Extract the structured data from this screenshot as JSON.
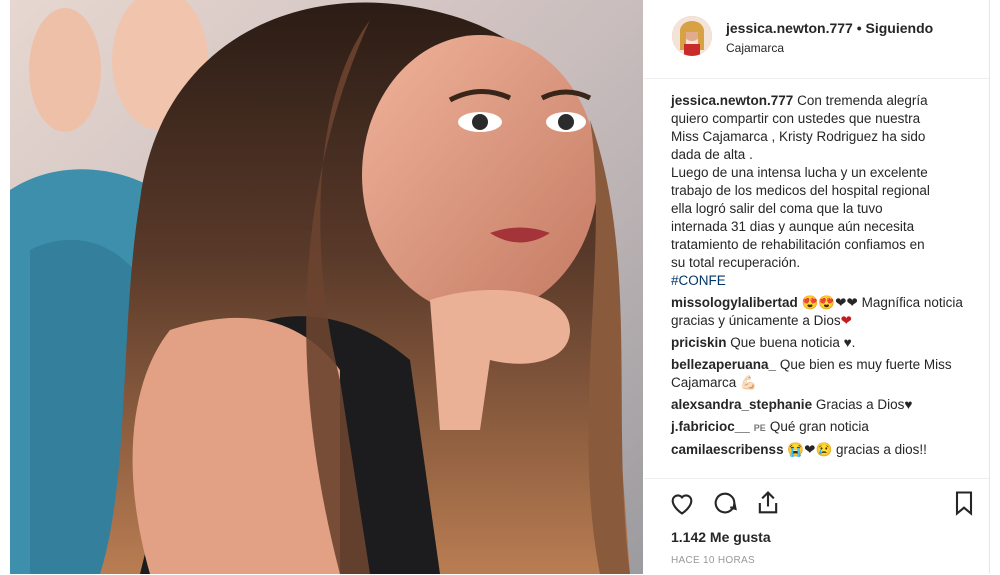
{
  "post": {
    "username": "jessica.newton.777",
    "separator": "•",
    "follow_status": "Siguiendo",
    "location": "Cajamarca"
  },
  "caption": {
    "username": "jessica.newton.777",
    "lines": [
      "Con tremenda alegría",
      "quiero compartir con ustedes que nuestra",
      "Miss Cajamarca , Kristy Rodriguez ha sido",
      "dada de alta .",
      "Luego de una intensa lucha y un excelente",
      "trabajo de los medicos del hospital regional",
      "ella logró salir del coma que la tuvo",
      "internada 31 dias y aunque aún necesita",
      "tratamiento de rehabilitación confiamos en",
      "su total recuperación."
    ],
    "hashtag": "#CONFE"
  },
  "comments": [
    {
      "user": "missologylalibertad",
      "text": "Magnífica noticia gracias y únicamente a Dios",
      "emoji": "😍😍❤❤",
      "tail": "❤"
    },
    {
      "user": "priciskin",
      "text": "Que buena noticia ♥."
    },
    {
      "user": "bellezaperuana_",
      "text": "Que bien es muy fuerte Miss Cajamarca 💪🏻"
    },
    {
      "user": "alexsandra_stephanie",
      "text": "Gracias a Dios♥"
    },
    {
      "user": "j.fabricioc__",
      "badge": "PE",
      "text": "Qué gran noticia"
    },
    {
      "user": "camilaescribenss",
      "emoji": "😭❤😢",
      "text": "gracias a dios!!"
    }
  ],
  "footer": {
    "likes": "1.142 Me gusta",
    "time": "HACE 10 HORAS"
  },
  "colors": {
    "accent": "#003569",
    "heart": "#c51d1d"
  }
}
